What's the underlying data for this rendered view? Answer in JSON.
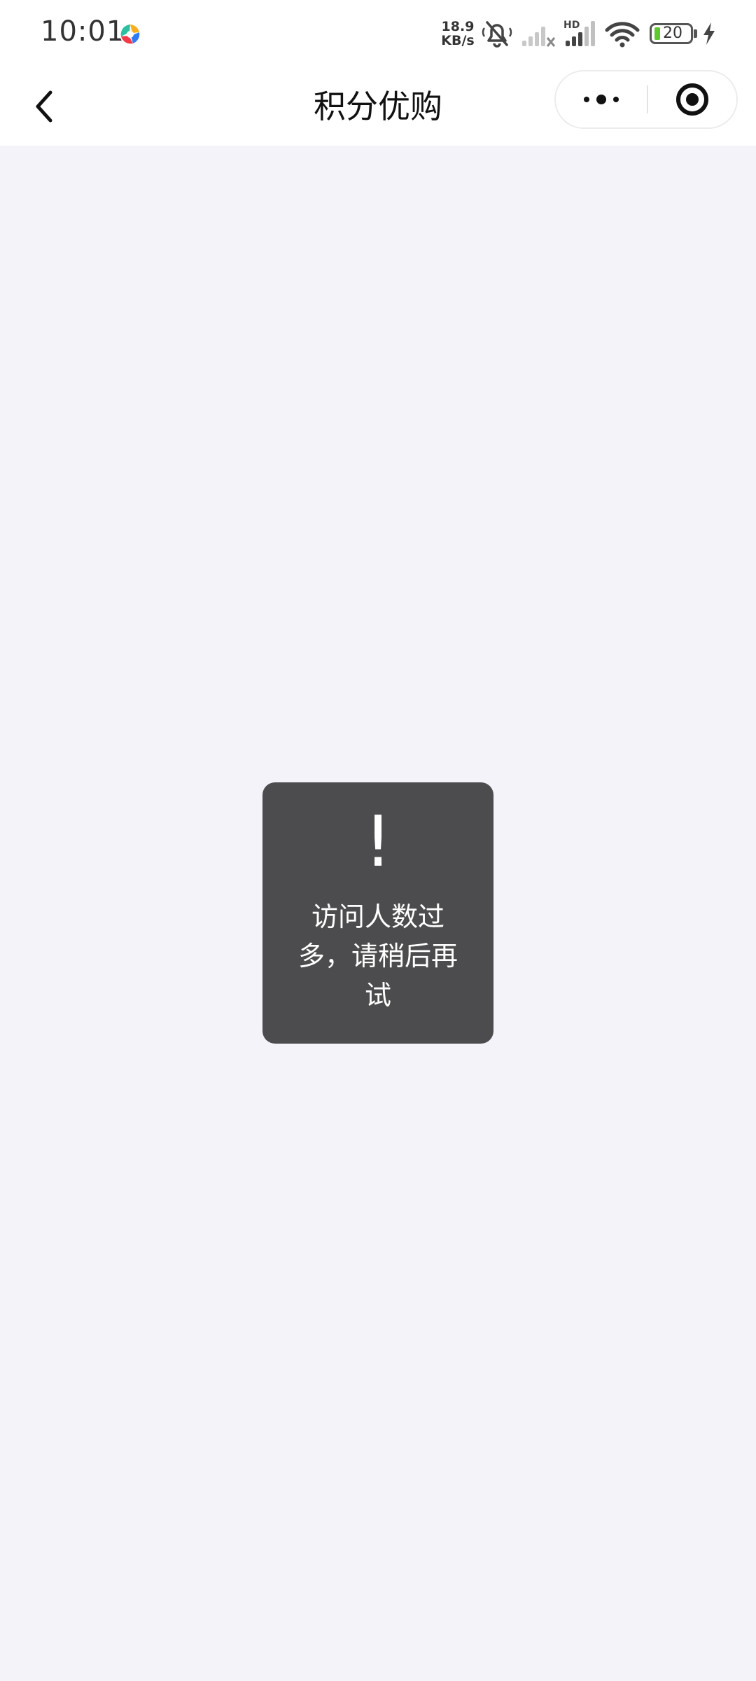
{
  "status_bar": {
    "time": "10:01",
    "net_speed_value": "18.9",
    "net_speed_unit": "KB/s",
    "battery_level": "20",
    "icons": [
      "colorful-app-icon",
      "mute-bell-icon",
      "signal-icon",
      "hd-signal-icon",
      "wifi-icon",
      "battery-icon",
      "charging-icon"
    ]
  },
  "nav": {
    "title": "积分优购",
    "back_icon": "chevron-left-icon",
    "more_icon": "more-dots-icon",
    "close_icon": "target-circle-icon"
  },
  "toast": {
    "icon": "!",
    "message": "访问人数过多，请稍后再试"
  },
  "colors": {
    "page_background": "#f4f3f9",
    "bar_background": "#ffffff",
    "toast_background": "#4c4c4e",
    "battery_green": "#5fc82f"
  }
}
